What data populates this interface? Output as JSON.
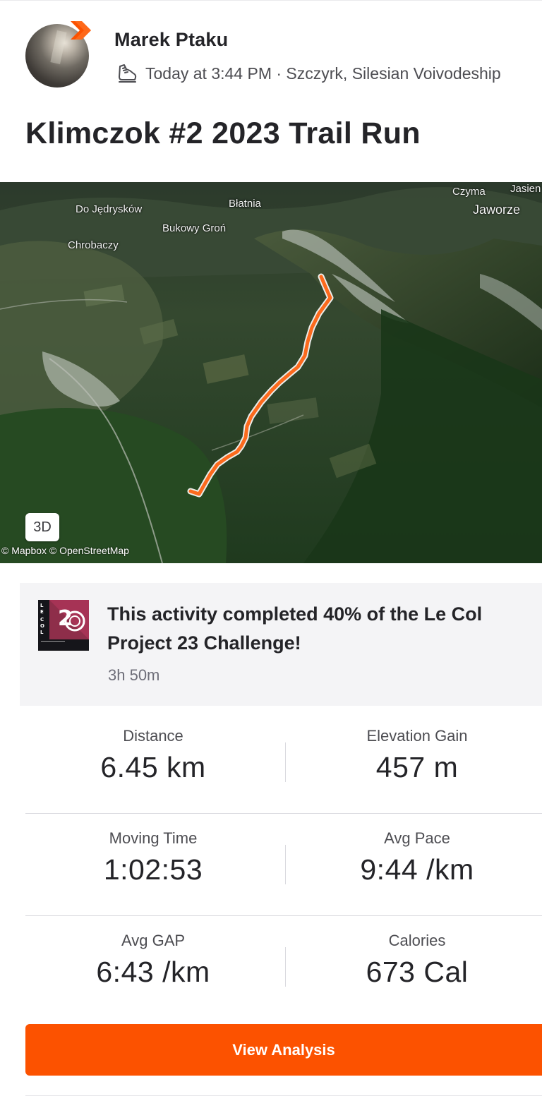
{
  "athlete": {
    "name": "Marek Ptaku",
    "avatar_icon": "avatar-photo",
    "subscription_badge_icon": "strava-chevron-badge",
    "activity_icon": "run-shoe-icon",
    "meta": "Today at 3:44 PM · Szczyrk, Silesian Voivodeship"
  },
  "activity": {
    "title": "Klimczok #2 2023 Trail Run"
  },
  "map": {
    "places": [
      "Do Jędrysków",
      "Błatnia",
      "Czyma",
      "Jasien",
      "Jaworze",
      "Bukowy Groń",
      "Chrobaczy"
    ],
    "toggle_3d_label": "3D",
    "attribution": "© Mapbox © OpenStreetMap",
    "route_color": "#fc6a1d"
  },
  "challenge": {
    "badge_icon": "le-col-project-23-badge",
    "text": "This activity completed 40% of the Le Col Project 23 Challenge!",
    "duration": "3h 50m",
    "progress_percent": 40
  },
  "stats": [
    {
      "label": "Distance",
      "value": "6.45 km"
    },
    {
      "label": "Elevation Gain",
      "value": "457 m"
    },
    {
      "label": "Moving Time",
      "value": "1:02:53"
    },
    {
      "label": "Avg Pace",
      "value": "9:44 /km"
    },
    {
      "label": "Avg GAP",
      "value": "6:43 /km"
    },
    {
      "label": "Calories",
      "value": "673 Cal"
    }
  ],
  "actions": {
    "view_analysis": "View Analysis"
  },
  "colors": {
    "brand_orange": "#fc5200",
    "text_primary": "#242428",
    "text_secondary": "#4d4d52"
  }
}
